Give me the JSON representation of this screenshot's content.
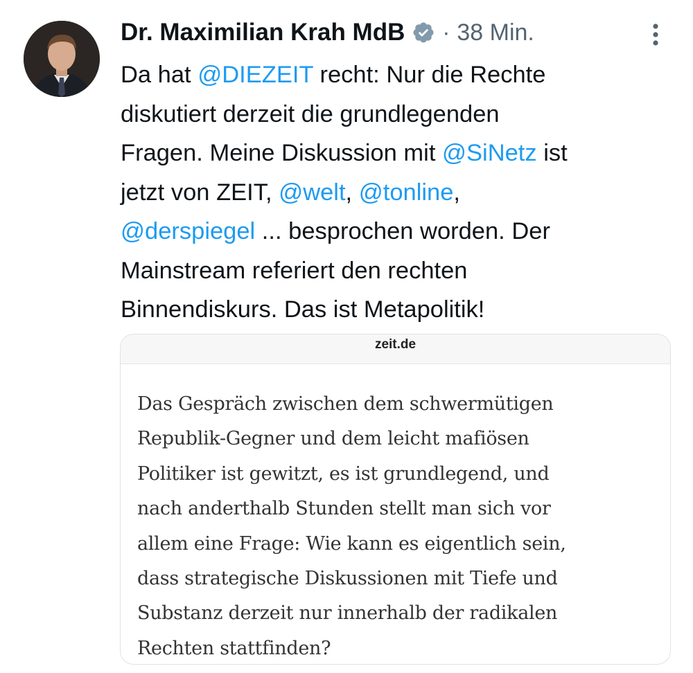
{
  "tweet": {
    "author_name": "Dr. Maximilian Krah MdB",
    "separator": "·",
    "time": "38 Min.",
    "verified_icon": "verified-badge-icon",
    "more_icon": "more-options-icon",
    "colors": {
      "mention": "#1d9bf0",
      "text": "#0f1419",
      "secondary": "#536471"
    },
    "lines": [
      [
        {
          "t": "Da hat "
        },
        {
          "t": "@DIEZEIT",
          "m": true
        },
        {
          "t": " recht: Nur die Rechte"
        }
      ],
      [
        {
          "t": "diskutiert derzeit die grundlegenden"
        }
      ],
      [
        {
          "t": "Fragen. Meine Diskussion mit "
        },
        {
          "t": "@SiNetz",
          "m": true
        },
        {
          "t": " ist"
        }
      ],
      [
        {
          "t": "jetzt von ZEIT, "
        },
        {
          "t": "@welt",
          "m": true
        },
        {
          "t": ", "
        },
        {
          "t": "@tonline",
          "m": true
        },
        {
          "t": ","
        }
      ],
      [
        {
          "t": "@derspiegel",
          "m": true
        },
        {
          "t": " ... besprochen worden. Der"
        }
      ],
      [
        {
          "t": "Mainstream referiert den rechten"
        }
      ],
      [
        {
          "t": "Binnendiskurs. Das ist Metapolitik!"
        }
      ]
    ]
  },
  "card": {
    "domain": "zeit.de",
    "lines": [
      "Das Gespräch zwischen dem schwermütigen",
      "Republik-Gegner und dem leicht mafiösen",
      "Politiker ist gewitzt, es ist grundlegend, und",
      "nach anderthalb Stunden stellt man sich vor",
      "allem eine Frage: Wie kann es eigentlich sein,",
      "dass strategische Diskussionen mit Tiefe und",
      "Substanz derzeit nur innerhalb der radikalen",
      "Rechten stattfinden?"
    ]
  }
}
